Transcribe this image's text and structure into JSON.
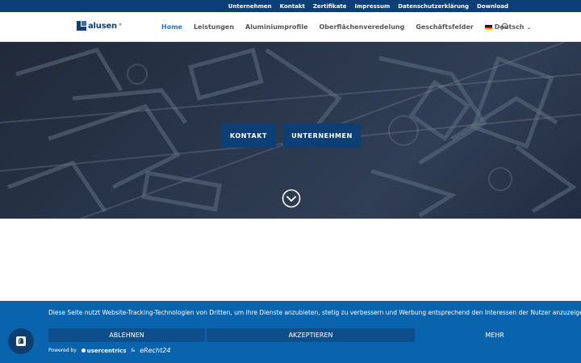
{
  "topbar": {
    "links": [
      "Unternehmen",
      "Kontakt",
      "Zertifikate",
      "Impressum",
      "Datenschutzerklärung",
      "Download"
    ]
  },
  "logo": {
    "text": "alusen"
  },
  "nav": {
    "items": [
      "Home",
      "Leistungen",
      "Aluminiumprofile",
      "Oberflächenveredelung",
      "Geschäftsfelder"
    ],
    "active": "Home",
    "language": "Deutsch"
  },
  "hero": {
    "buttons": {
      "kontakt": "KONTAKT",
      "unternehmen": "UNTERNEHMEN"
    }
  },
  "cookie": {
    "text": "Diese Seite nutzt Website-Tracking-Technologien von Dritten, um ihre Dienste anzubieten, stetig zu verbessern und Werbung entsprechend den Interessen der Nutzer anzuzeigen.",
    "deny": "ABLEHNEN",
    "accept": "AKZEPTIEREN",
    "more": "MEHR",
    "powered_by": "Powered by",
    "usercentrics": "usercentrics",
    "amp": "&",
    "erecht": "eRecht24"
  },
  "colors": {
    "brand": "#0c3f75",
    "nav_active": "#2a75c0",
    "cookie_bg": "#0a63ad"
  }
}
